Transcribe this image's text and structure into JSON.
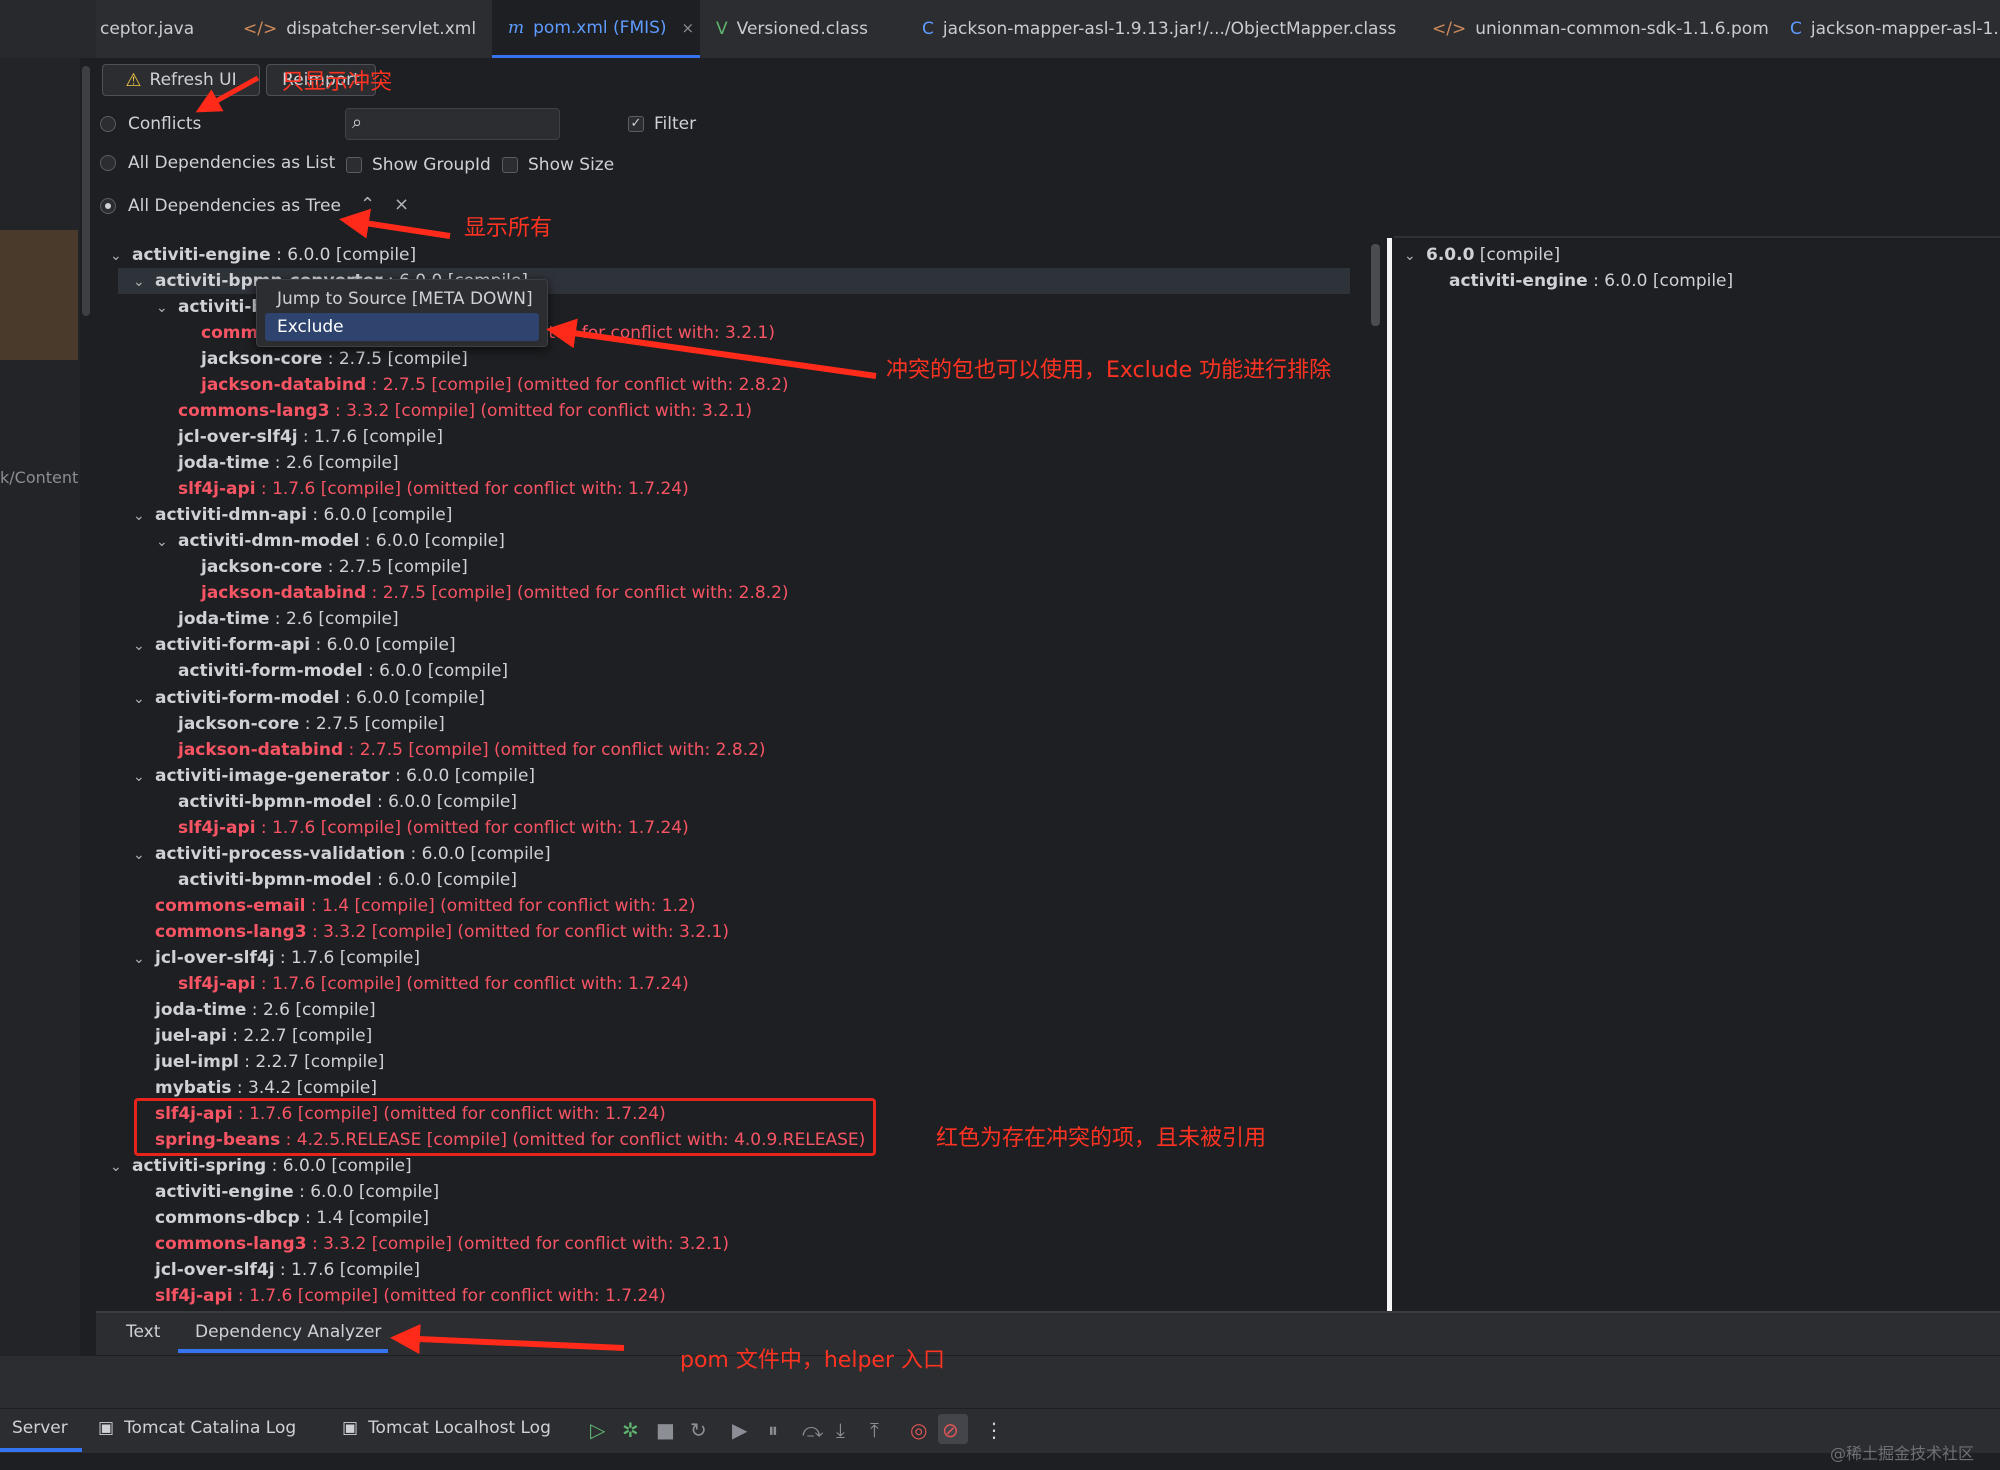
{
  "tabs": [
    {
      "label": "ceptor.java",
      "icon": "",
      "active": false
    },
    {
      "label": "dispatcher-servlet.xml",
      "icon": "</>",
      "active": false
    },
    {
      "label": "pom.xml (FMIS)",
      "icon": "m",
      "active": true
    },
    {
      "label": "Versioned.class",
      "icon": "V",
      "active": false
    },
    {
      "label": "jackson-mapper-asl-1.9.13.jar!/.../ObjectMapper.class",
      "icon": "C",
      "active": false
    },
    {
      "label": "unionman-common-sdk-1.1.6.pom",
      "icon": "</>",
      "active": false
    },
    {
      "label": "jackson-mapper-asl-1.",
      "icon": "C",
      "active": false
    }
  ],
  "tab_close_glyph": "×",
  "left_side_label": "k/Content",
  "toolbar": {
    "refresh_label": "Refresh UI",
    "reimport_label": "Reimport",
    "filter_label": "Filter",
    "filter_checked": true,
    "show_groupid_label": "Show GroupId",
    "show_size_label": "Show Size",
    "search_value": ""
  },
  "view_modes": [
    {
      "label": "Conflicts",
      "selected": false
    },
    {
      "label": "All Dependencies as List",
      "selected": false
    },
    {
      "label": "All Dependencies as Tree",
      "selected": true
    }
  ],
  "tree_rows": [
    {
      "level": 0,
      "exp": true,
      "name": "activiti-engine",
      "rest": " : 6.0.0 [compile]",
      "conflict": false
    },
    {
      "level": 1,
      "exp": true,
      "name": "activiti-bpmn-converter",
      "rest": " : 6.0.0 [compile]",
      "conflict": false
    },
    {
      "level": 2,
      "exp": true,
      "name": "activiti-bpmn-model",
      "rest": " : 6.0.0 [compile]",
      "conflict": false
    },
    {
      "level": 3,
      "exp": false,
      "name": "commons-lang3",
      "rest": " : 3.3.2 [compile] (omitted for conflict with: 3.2.1)",
      "conflict": true
    },
    {
      "level": 3,
      "exp": false,
      "name": "jackson-core",
      "rest": " : 2.7.5 [compile]",
      "conflict": false
    },
    {
      "level": 3,
      "exp": false,
      "name": "jackson-databind",
      "rest": " : 2.7.5 [compile] (omitted for conflict with: 2.8.2)",
      "conflict": true
    },
    {
      "level": 2,
      "exp": false,
      "name": "commons-lang3",
      "rest": " : 3.3.2 [compile] (omitted for conflict with: 3.2.1)",
      "conflict": true
    },
    {
      "level": 2,
      "exp": false,
      "name": "jcl-over-slf4j",
      "rest": " : 1.7.6 [compile]",
      "conflict": false
    },
    {
      "level": 2,
      "exp": false,
      "name": "joda-time",
      "rest": " : 2.6 [compile]",
      "conflict": false
    },
    {
      "level": 2,
      "exp": false,
      "name": "slf4j-api",
      "rest": " : 1.7.6 [compile] (omitted for conflict with: 1.7.24)",
      "conflict": true
    },
    {
      "level": 1,
      "exp": true,
      "name": "activiti-dmn-api",
      "rest": " : 6.0.0 [compile]",
      "conflict": false
    },
    {
      "level": 2,
      "exp": true,
      "name": "activiti-dmn-model",
      "rest": " : 6.0.0 [compile]",
      "conflict": false
    },
    {
      "level": 3,
      "exp": false,
      "name": "jackson-core",
      "rest": " : 2.7.5 [compile]",
      "conflict": false
    },
    {
      "level": 3,
      "exp": false,
      "name": "jackson-databind",
      "rest": " : 2.7.5 [compile] (omitted for conflict with: 2.8.2)",
      "conflict": true
    },
    {
      "level": 2,
      "exp": false,
      "name": "joda-time",
      "rest": " : 2.6 [compile]",
      "conflict": false
    },
    {
      "level": 1,
      "exp": true,
      "name": "activiti-form-api",
      "rest": " : 6.0.0 [compile]",
      "conflict": false
    },
    {
      "level": 2,
      "exp": false,
      "name": "activiti-form-model",
      "rest": " : 6.0.0 [compile]",
      "conflict": false
    },
    {
      "level": 1,
      "exp": true,
      "name": "activiti-form-model",
      "rest": " : 6.0.0 [compile]",
      "conflict": false
    },
    {
      "level": 2,
      "exp": false,
      "name": "jackson-core",
      "rest": " : 2.7.5 [compile]",
      "conflict": false
    },
    {
      "level": 2,
      "exp": false,
      "name": "jackson-databind",
      "rest": " : 2.7.5 [compile] (omitted for conflict with: 2.8.2)",
      "conflict": true
    },
    {
      "level": 1,
      "exp": true,
      "name": "activiti-image-generator",
      "rest": " : 6.0.0 [compile]",
      "conflict": false
    },
    {
      "level": 2,
      "exp": false,
      "name": "activiti-bpmn-model",
      "rest": " : 6.0.0 [compile]",
      "conflict": false
    },
    {
      "level": 2,
      "exp": false,
      "name": "slf4j-api",
      "rest": " : 1.7.6 [compile] (omitted for conflict with: 1.7.24)",
      "conflict": true
    },
    {
      "level": 1,
      "exp": true,
      "name": "activiti-process-validation",
      "rest": " : 6.0.0 [compile]",
      "conflict": false
    },
    {
      "level": 2,
      "exp": false,
      "name": "activiti-bpmn-model",
      "rest": " : 6.0.0 [compile]",
      "conflict": false
    },
    {
      "level": 1,
      "exp": false,
      "name": "commons-email",
      "rest": " : 1.4 [compile] (omitted for conflict with: 1.2)",
      "conflict": true
    },
    {
      "level": 1,
      "exp": false,
      "name": "commons-lang3",
      "rest": " : 3.3.2 [compile] (omitted for conflict with: 3.2.1)",
      "conflict": true
    },
    {
      "level": 1,
      "exp": true,
      "name": "jcl-over-slf4j",
      "rest": " : 1.7.6 [compile]",
      "conflict": false
    },
    {
      "level": 2,
      "exp": false,
      "name": "slf4j-api",
      "rest": " : 1.7.6 [compile] (omitted for conflict with: 1.7.24)",
      "conflict": true
    },
    {
      "level": 1,
      "exp": false,
      "name": "joda-time",
      "rest": " : 2.6 [compile]",
      "conflict": false
    },
    {
      "level": 1,
      "exp": false,
      "name": "juel-api",
      "rest": " : 2.2.7 [compile]",
      "conflict": false
    },
    {
      "level": 1,
      "exp": false,
      "name": "juel-impl",
      "rest": " : 2.2.7 [compile]",
      "conflict": false
    },
    {
      "level": 1,
      "exp": false,
      "name": "mybatis",
      "rest": " : 3.4.2 [compile]",
      "conflict": false
    },
    {
      "level": 1,
      "exp": false,
      "name": "slf4j-api",
      "rest": " : 1.7.6 [compile] (omitted for conflict with: 1.7.24)",
      "conflict": true
    },
    {
      "level": 1,
      "exp": false,
      "name": "spring-beans",
      "rest": " : 4.2.5.RELEASE [compile] (omitted for conflict with: 4.0.9.RELEASE)",
      "conflict": true
    },
    {
      "level": 0,
      "exp": true,
      "name": "activiti-spring",
      "rest": " : 6.0.0 [compile]",
      "conflict": false
    },
    {
      "level": 1,
      "exp": false,
      "name": "activiti-engine",
      "rest": " : 6.0.0 [compile]",
      "conflict": false
    },
    {
      "level": 1,
      "exp": false,
      "name": "commons-dbcp",
      "rest": " : 1.4 [compile]",
      "conflict": false
    },
    {
      "level": 1,
      "exp": false,
      "name": "commons-lang3",
      "rest": " : 3.3.2 [compile] (omitted for conflict with: 3.2.1)",
      "conflict": true
    },
    {
      "level": 1,
      "exp": false,
      "name": "jcl-over-slf4j",
      "rest": " : 1.7.6 [compile]",
      "conflict": false
    },
    {
      "level": 1,
      "exp": false,
      "name": "slf4j-api",
      "rest": " : 1.7.6 [compile] (omitted for conflict with: 1.7.24)",
      "conflict": true
    }
  ],
  "right_rows": [
    {
      "level": 0,
      "exp": true,
      "name": "6.0.0",
      "rest": " [compile]",
      "conflict": false
    },
    {
      "level": 1,
      "exp": false,
      "name": "activiti-engine",
      "rest": " : 6.0.0 [compile]",
      "conflict": false
    }
  ],
  "context_menu": {
    "jump_label": "Jump to Source [META DOWN]",
    "exclude_label": "Exclude"
  },
  "bottom_tabs": {
    "text_label": "Text",
    "analyzer_label": "Dependency Analyzer"
  },
  "services": {
    "server_label": "Server",
    "catalina_label": "Tomcat Catalina Log",
    "localhost_label": "Tomcat Localhost Log"
  },
  "annotations": {
    "only_conflicts": "只显示冲突",
    "show_all": "显示所有",
    "exclude_note": "冲突的包也可以使用，Exclude 功能进行排除",
    "red_note": "红色为存在冲突的项，且未被引用",
    "pom_note": "pom 文件中，helper 入口"
  },
  "watermark": "@稀土掘金技术社区",
  "colors": {
    "conflict": "#f75464",
    "annotation": "#ff3322",
    "accent": "#3574f0"
  }
}
